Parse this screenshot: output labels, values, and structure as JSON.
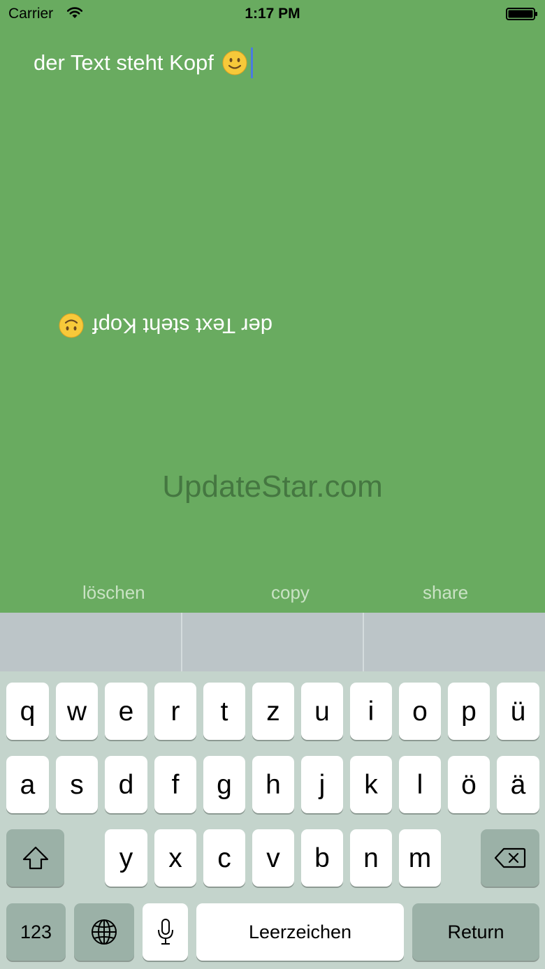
{
  "status_bar": {
    "carrier": "Carrier",
    "time": "1:17 PM"
  },
  "editor": {
    "input_text": "der Text steht Kopf",
    "flipped_text": "der Text steht Kopf"
  },
  "watermark": "UpdateStar.com",
  "actions": {
    "delete": "löschen",
    "copy": "copy",
    "share": "share"
  },
  "keyboard": {
    "row1": [
      "q",
      "w",
      "e",
      "r",
      "t",
      "z",
      "u",
      "i",
      "o",
      "p",
      "ü"
    ],
    "row2": [
      "a",
      "s",
      "d",
      "f",
      "g",
      "h",
      "j",
      "k",
      "l",
      "ö",
      "ä"
    ],
    "row3": [
      "y",
      "x",
      "c",
      "v",
      "b",
      "n",
      "m"
    ],
    "numbers_label": "123",
    "space_label": "Leerzeichen",
    "return_label": "Return"
  },
  "colors": {
    "background": "#69ab60",
    "cursor": "#4a7be0",
    "keyboard": "#c4d4cc"
  }
}
